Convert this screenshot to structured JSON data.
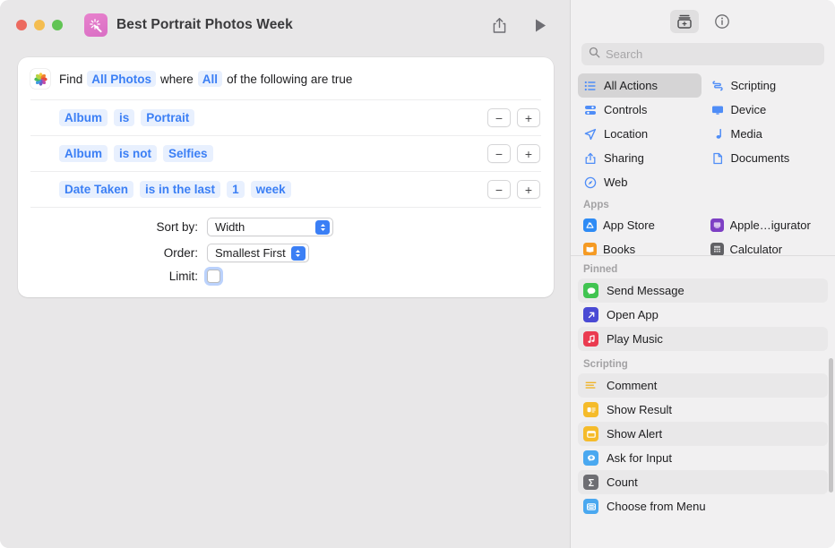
{
  "window": {
    "title": "Best Portrait Photos Week",
    "shortcut_icon": "sparkle-wand-icon",
    "shortcut_icon_color": "#dd72c6",
    "traffic_lights": [
      "close",
      "minimize",
      "zoom"
    ],
    "share_label": "Share",
    "run_label": "Run"
  },
  "action": {
    "app_icon": "photos-app-icon",
    "header": {
      "find_label": "Find",
      "source": "All Photos",
      "where_label": "where",
      "match": "All",
      "suffix_label": "of the following are true"
    },
    "rules": [
      {
        "field": "Album",
        "operator": "is",
        "value": "Portrait"
      },
      {
        "field": "Album",
        "operator": "is not",
        "value": "Selfies"
      },
      {
        "field": "Date Taken",
        "operator": "is in the last",
        "value": "1",
        "unit": "week"
      }
    ],
    "row_buttons": {
      "remove": "−",
      "add": "+"
    },
    "options": {
      "sort_by_label": "Sort by:",
      "sort_by_value": "Width",
      "order_label": "Order:",
      "order_value": "Smallest First",
      "limit_label": "Limit:",
      "limit_checked": false
    }
  },
  "sidebar": {
    "toolbar": [
      {
        "name": "action-library-icon",
        "active": true
      },
      {
        "name": "info-icon",
        "active": false
      }
    ],
    "search": {
      "placeholder": "Search",
      "value": "",
      "icon": "search-icon"
    },
    "categories": [
      {
        "label": "All Actions",
        "icon": "list-bullet-icon",
        "selected": true
      },
      {
        "label": "Scripting",
        "icon": "scroll-icon",
        "selected": false
      },
      {
        "label": "Controls",
        "icon": "sliders-icon",
        "selected": false
      },
      {
        "label": "Device",
        "icon": "display-icon",
        "selected": false
      },
      {
        "label": "Location",
        "icon": "paper-plane-icon",
        "selected": false
      },
      {
        "label": "Media",
        "icon": "music-note-icon",
        "selected": false
      },
      {
        "label": "Sharing",
        "icon": "share-icon",
        "selected": false
      },
      {
        "label": "Documents",
        "icon": "document-icon",
        "selected": false
      },
      {
        "label": "Web",
        "icon": "compass-icon",
        "selected": false
      }
    ],
    "apps_section_label": "Apps",
    "apps": [
      {
        "label": "App Store",
        "icon": "app-store-icon",
        "color": "#2e8bf5",
        "glyph": "A"
      },
      {
        "label": "Apple…igurator",
        "icon": "apple-configurator-icon",
        "color": "#7d3fc4",
        "glyph": "■"
      },
      {
        "label": "Books",
        "icon": "books-icon",
        "color": "#f59a23",
        "glyph": "■"
      },
      {
        "label": "Calculator",
        "icon": "calculator-icon",
        "color": "#616165",
        "glyph": "■"
      }
    ],
    "pinned_section_label": "Pinned",
    "pinned": [
      {
        "label": "Send Message",
        "icon": "message-bubble-icon",
        "color": "#41c451",
        "glyph": "💬"
      },
      {
        "label": "Open App",
        "icon": "arrow-diagonal-icon",
        "color": "#4a4ad4",
        "glyph": "↗"
      },
      {
        "label": "Play Music",
        "icon": "music-note-icon",
        "color": "#ea3b50",
        "glyph": "♪"
      }
    ],
    "scripting_section_label": "Scripting",
    "scripting": [
      {
        "label": "Comment",
        "icon": "comment-lines-icon",
        "color": "#f0b429",
        "glyph": "≡"
      },
      {
        "label": "Show Result",
        "icon": "show-result-icon",
        "color": "#f5bb2a",
        "glyph": "▣"
      },
      {
        "label": "Show Alert",
        "icon": "show-alert-icon",
        "color": "#f5bb2a",
        "glyph": "▭"
      },
      {
        "label": "Ask for Input",
        "icon": "ask-input-icon",
        "color": "#4aa8f0",
        "glyph": "■"
      },
      {
        "label": "Count",
        "icon": "sigma-count-icon",
        "color": "#6e6e73",
        "glyph": "Σ"
      },
      {
        "label": "Choose from Menu",
        "icon": "choose-menu-icon",
        "color": "#4aa8f0",
        "glyph": "▤"
      }
    ]
  }
}
